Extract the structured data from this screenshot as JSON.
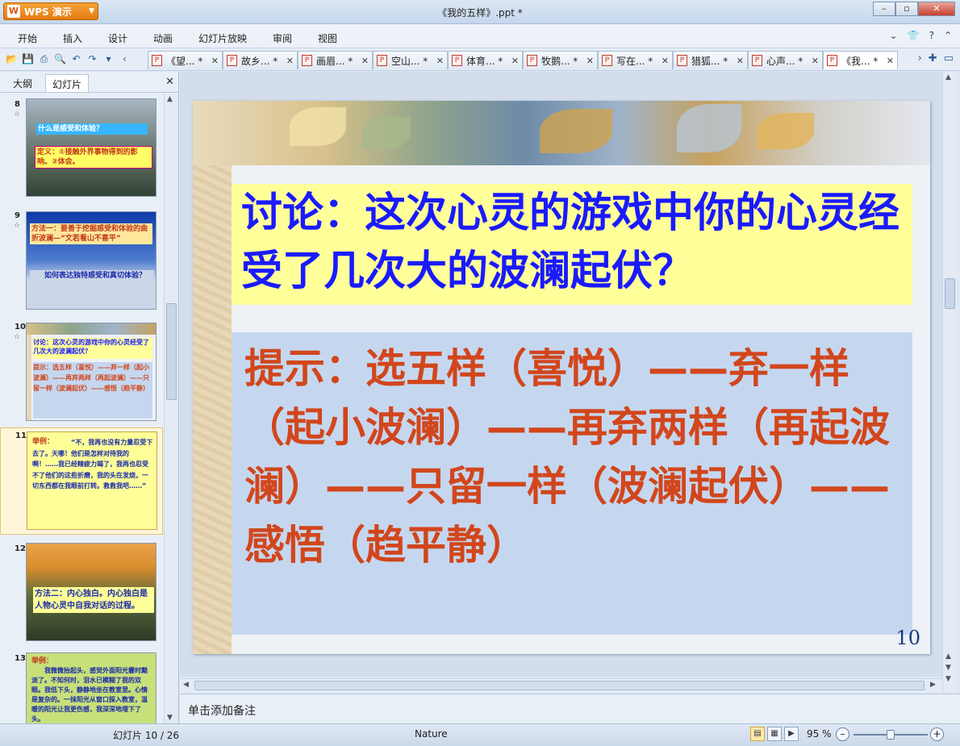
{
  "app": {
    "button_label": "WPS 演示",
    "window_title": "《我的五样》.ppt *",
    "window_controls": [
      "minimize-icon",
      "maximize-icon",
      "close-icon"
    ]
  },
  "menu": {
    "items": [
      "开始",
      "插入",
      "设计",
      "动画",
      "幻灯片放映",
      "审阅",
      "视图"
    ]
  },
  "doc_tabs": [
    {
      "label": "《望... *",
      "active": false
    },
    {
      "label": "故乡... *",
      "active": false
    },
    {
      "label": "画眉... *",
      "active": false
    },
    {
      "label": "空山... *",
      "active": false
    },
    {
      "label": "体育... *",
      "active": false
    },
    {
      "label": "牧鹅... *",
      "active": false
    },
    {
      "label": "写在... *",
      "active": false
    },
    {
      "label": "猎狐... *",
      "active": false
    },
    {
      "label": "心声... *",
      "active": false
    },
    {
      "label": "《我... *",
      "active": true
    }
  ],
  "left_panel": {
    "tab_outline": "大纲",
    "tab_slides": "幻灯片",
    "thumbnails": [
      {
        "num": "8",
        "star": "☆",
        "lines": [
          "什么是感受和体验？",
          "定义：①接触外界事物得到的影响。②体会。"
        ]
      },
      {
        "num": "9",
        "star": "☆",
        "lines": [
          "方法一：要善于挖掘感受和体验的曲折波澜—“文若看山不喜平”",
          "如何表达独特感受和真切体验？"
        ]
      },
      {
        "num": "10",
        "star": "☆",
        "lines": [
          "讨论：这次心灵的游戏中你的心灵经受了几次大的波澜起伏？",
          "提示：选五样（喜悦）——弃一样（起小波澜）——再弃两样（再起波澜）——只留一样（波澜起伏）——感悟（趋平静）"
        ]
      },
      {
        "num": "11",
        "star": "",
        "lines": [
          "举例：",
          "“不，我再也没有力量忍受下去了。天哪！他们是怎样对待我的啊！……我已经精疲力竭了，我再也忍受不了他们的这些折磨，我的头在发烧，一切东西都在我眼前打转。救救我吧……”"
        ]
      },
      {
        "num": "12",
        "star": "",
        "lines": [
          "方法二：内心独白。内心独白是人物心灵中自我对话的过程。"
        ]
      },
      {
        "num": "13",
        "star": "",
        "lines": [
          "举例：",
          "我微微抬起头，感觉外面阳光霎时黯淡了。不知何时，泪水已模糊了我的双眼。我低下头，静静地坐在教室里。心情是复杂的。一抹阳光从窗口探入教室，温暖的阳光让我更伤感，我深深地埋下了头。"
        ]
      }
    ]
  },
  "slide": {
    "title": "讨论：这次心灵的游戏中你的心灵经受了几次大的波澜起伏？",
    "hint": "提示：选五样（喜悦）——弃一样（起小波澜）——再弃两样（再起波澜）——只留一样（波澜起伏）——感悟（趋平静）",
    "number": "10"
  },
  "notes_placeholder": "单击添加备注",
  "status": {
    "slide_position": "幻灯片 10 / 26",
    "theme": "Nature",
    "zoom": "95 %",
    "zoom_fraction": 0.5
  },
  "colors": {
    "title_text": "#1a1aff",
    "title_bg": "#ffff99",
    "hint_text": "#d2461c",
    "hint_bg": "#c5d7ef"
  }
}
